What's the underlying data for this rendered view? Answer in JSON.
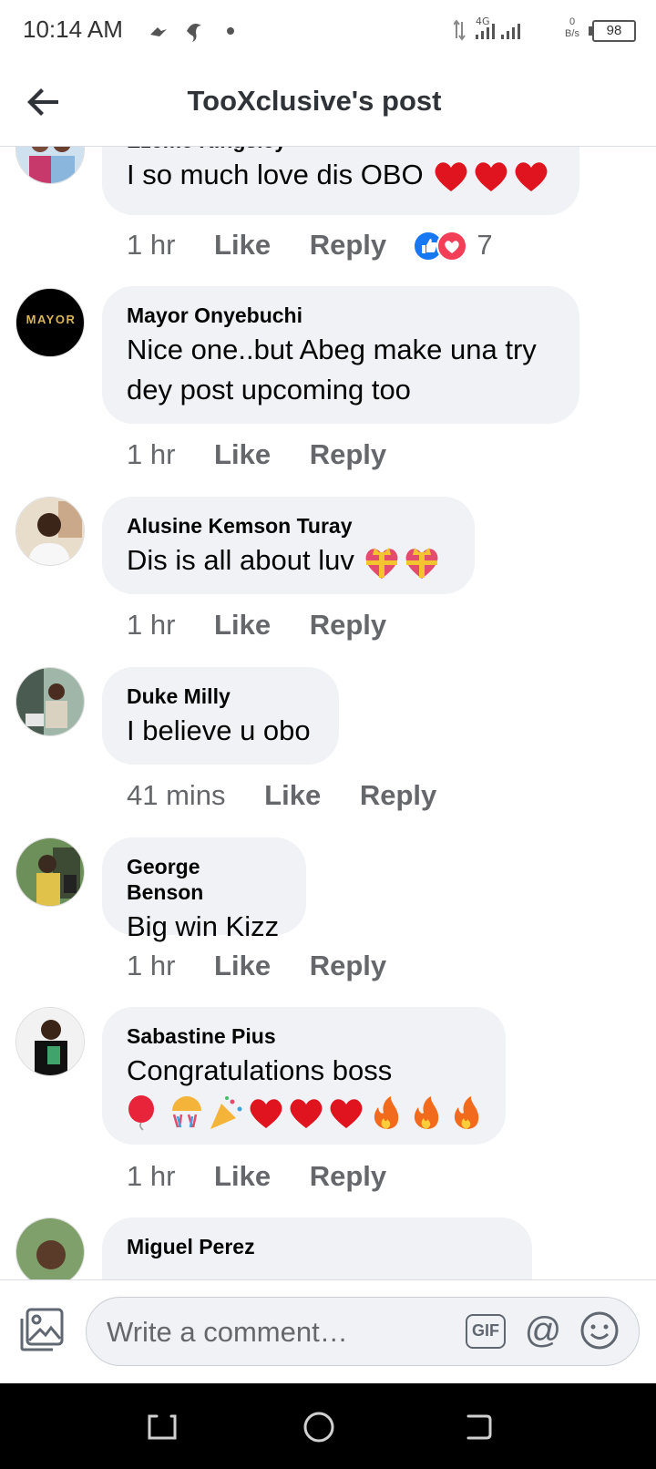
{
  "status_bar": {
    "time": "10:14 AM",
    "network": "4G",
    "net_speed_value": "0",
    "net_speed_unit": "B/s",
    "battery": "98"
  },
  "header": {
    "title": "TooXclusive's post",
    "back_icon": "back-arrow-icon"
  },
  "comments": [
    {
      "author": "Ezeme Kingsley",
      "text": "I so much love dis OBO",
      "emojis": [
        "heart",
        "heart",
        "heart"
      ],
      "time": "1 hr",
      "like_label": "Like",
      "reply_label": "Reply",
      "reactions": [
        "like",
        "love"
      ],
      "reaction_count": "7"
    },
    {
      "author": "Mayor Onyebuchi",
      "avatar_text": "MAYOR",
      "text": "Nice one..but Abeg make una try dey post upcoming too",
      "time": "1 hr",
      "like_label": "Like",
      "reply_label": "Reply"
    },
    {
      "author": "Alusine Kemson Turay",
      "text": "Dis is all about luv",
      "emojis": [
        "gift-heart",
        "gift-heart"
      ],
      "time": "1 hr",
      "like_label": "Like",
      "reply_label": "Reply"
    },
    {
      "author": "Duke Milly",
      "text": "I believe u obo",
      "time": "41 mins",
      "like_label": "Like",
      "reply_label": "Reply"
    },
    {
      "author": "George Benson",
      "text": "Big win Kizz",
      "time": "1 hr",
      "like_label": "Like",
      "reply_label": "Reply"
    },
    {
      "author": "Sabastine Pius",
      "text": "Congratulations boss",
      "emojis": [
        "balloon",
        "confetti-ball",
        "party-popper",
        "heart",
        "heart",
        "heart",
        "fire",
        "fire",
        "fire"
      ],
      "time": "1 hr",
      "like_label": "Like",
      "reply_label": "Reply"
    },
    {
      "author": "Miguel Perez"
    }
  ],
  "composer": {
    "placeholder": "Write a comment…",
    "gif_label": "GIF",
    "at_label": "@"
  },
  "colors": {
    "bubble": "#f0f2f5",
    "meta_text": "#65676b",
    "like_blue": "#1877f2",
    "love_red": "#f33e58",
    "heart_red": "#e0141e"
  }
}
